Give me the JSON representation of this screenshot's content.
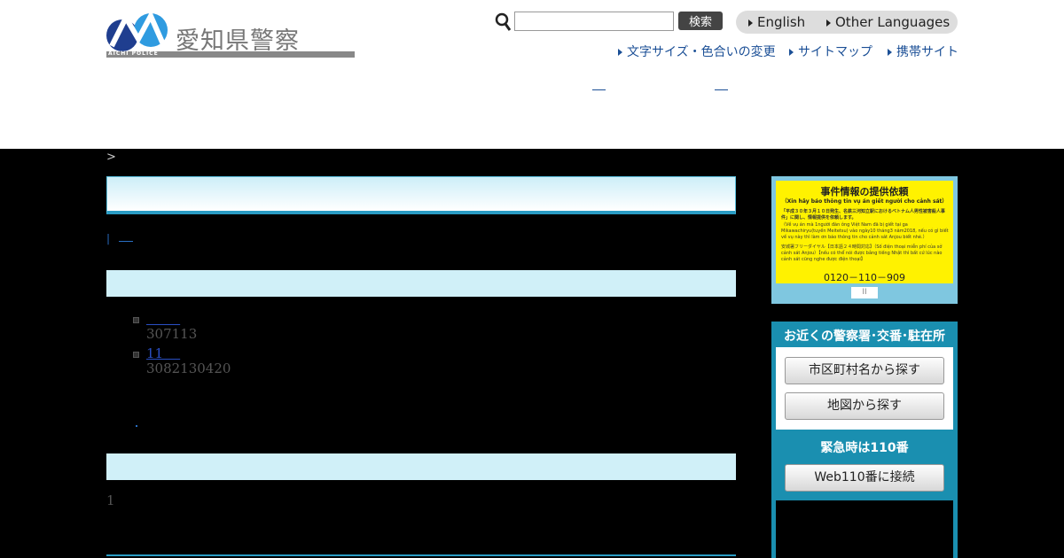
{
  "header": {
    "logo_text": "愛知県警察",
    "logo_sub": "AICHI POLICE",
    "search": {
      "placeholder": "",
      "value": "",
      "button_label": "検索"
    },
    "languages": [
      {
        "label": "English"
      },
      {
        "label": "Other Languages"
      }
    ],
    "utility_links": [
      {
        "label": "文字サイズ・色合いの変更"
      },
      {
        "label": "サイトマップ"
      },
      {
        "label": "携帯サイト"
      }
    ]
  },
  "breadcrumb": ">",
  "page_links": "|",
  "main": {
    "list": [
      {
        "link": "        ",
        "sub": "307113"
      },
      {
        "link": "11    ",
        "sub": "3082130420"
      }
    ],
    "body_text": "1"
  },
  "sidebar": {
    "banner": {
      "title": "事件情報の提供依頼",
      "subtitle": "（Xin hãy báo thông tin vụ án giết người cho cảnh sát）",
      "para1": "「平成３０年３月１０日発生、名鉄三河知立駅におけるベトナム人男性被害殺人事件」に関し、情報提供を依頼します。",
      "para2": "（Về vụ án mà 1người đàn ông Việt Nam đã bị giết tại ga Mikawachiryu(tuyến Meitetsu) vào ngày10 tháng3 năm2018, nếu có gì biết về vụ này thì làm ơn báo thông tin cho cảnh sát Anjou biết nhé.）",
      "para3": "安城署フリーダイヤル【日本語２４時間対応】（Số điện thoại miễn phí của sở cảnh sát Anjou）【nếu có thể nói được bằng tiếng Nhật thì bất cứ lúc nào cảnh sát cũng nghe được điện thoại】",
      "phone": "0120－110－909",
      "pause_label": "II"
    },
    "stations": {
      "title": "お近くの警察署･交番･駐在所",
      "buttons": [
        {
          "label": "市区町村名から探す"
        },
        {
          "label": "地図から探す"
        }
      ],
      "emergency_label": "緊急時は110番",
      "web110_label": "Web110番に接続"
    }
  },
  "colors": {
    "accent": "#2a9cc4",
    "section_bar": "#d0f0f8",
    "banner_yellow": "#fff200",
    "station_teal": "#1a8fb0",
    "link_blue": "#1b4f96"
  }
}
